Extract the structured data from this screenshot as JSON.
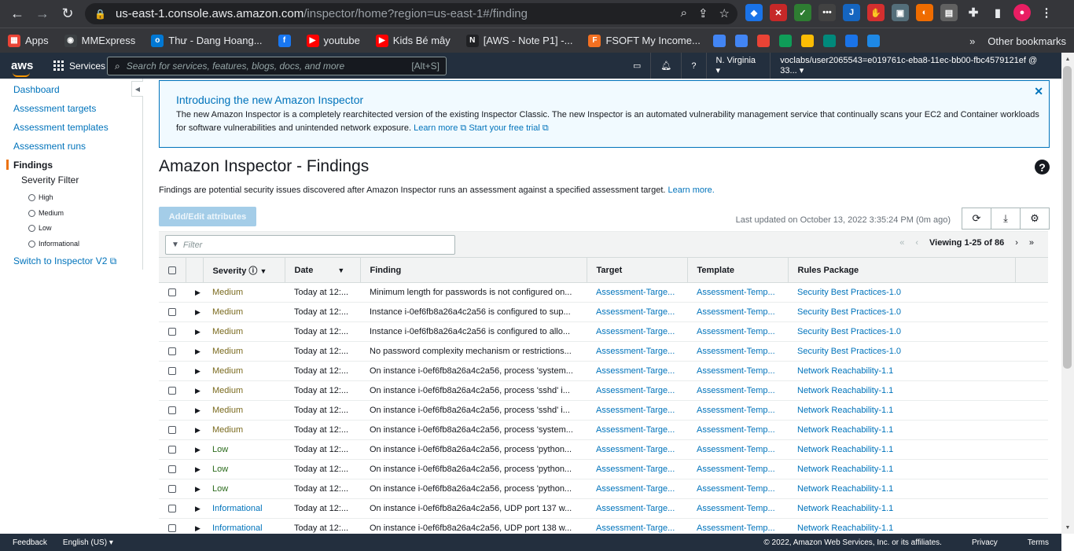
{
  "browser": {
    "url_host": "us-east-1.console.aws.amazon.com",
    "url_path": "/inspector/home?region=us-east-1#/finding",
    "bookmarks": [
      {
        "label": "Apps",
        "color": "#ea4335",
        "glyph": "▦"
      },
      {
        "label": "MMExpress",
        "color": "#3c4043",
        "glyph": "◉"
      },
      {
        "label": "Thư - Dang Hoang...",
        "color": "#0078d4",
        "glyph": "o"
      },
      {
        "label": "",
        "color": "#1877f2",
        "glyph": "f"
      },
      {
        "label": "youtube",
        "color": "#ff0000",
        "glyph": "▶"
      },
      {
        "label": "Kids Bé mây",
        "color": "#ff0000",
        "glyph": "▶"
      },
      {
        "label": "[AWS - Note P1] -...",
        "color": "#202124",
        "glyph": "N"
      },
      {
        "label": "FSOFT My Income...",
        "color": "#f37021",
        "glyph": "F"
      }
    ],
    "other_bookmarks": "Other bookmarks"
  },
  "aws_nav": {
    "logo": "aws",
    "services": "Services",
    "search_placeholder": "Search for services, features, blogs, docs, and more",
    "search_hint": "[Alt+S]",
    "region": "N. Virginia ▾",
    "account": "voclabs/user2065543=e019761c-eba8-11ec-bb00-fbc4579121ef @ 33... ▾"
  },
  "sidebar": {
    "items": [
      "Dashboard",
      "Assessment targets",
      "Assessment templates",
      "Assessment runs",
      "Findings"
    ],
    "severity_filter": "Severity Filter",
    "severities": [
      "High",
      "Medium",
      "Low",
      "Informational"
    ],
    "switch_v2": "Switch to Inspector V2 ⧉"
  },
  "banner": {
    "title": "Introducing the new Amazon Inspector",
    "text": "The new Amazon Inspector is a completely rearchitected version of the existing Inspector Classic. The new Inspector is an automated vulnerability management service that continually scans your EC2 and Container workloads for software vulnerabilities and unintended network exposure.",
    "learn_more": "Learn more ⧉",
    "free_trial": "Start your free trial ⧉"
  },
  "page": {
    "title": "Amazon Inspector - Findings",
    "description": "Findings are potential security issues discovered after Amazon Inspector runs an assessment against a specified assessment target.",
    "description_link": "Learn more.",
    "add_edit_button": "Add/Edit attributes",
    "last_updated": "Last updated on October 13, 2022 3:35:24 PM (0m ago)",
    "filter_placeholder": "Filter",
    "viewing": "Viewing 1-25 of 86"
  },
  "table": {
    "columns": [
      "Severity ⓘ",
      "Date",
      "Finding",
      "Target",
      "Template",
      "Rules Package"
    ],
    "rows": [
      {
        "severity": "Medium",
        "date": "Today at 12:...",
        "finding": "Minimum length for passwords is not configured on...",
        "target": "Assessment-Targe...",
        "template": "Assessment-Temp...",
        "rules": "Security Best Practices-1.0"
      },
      {
        "severity": "Medium",
        "date": "Today at 12:...",
        "finding": "Instance i-0ef6fb8a26a4c2a56 is configured to sup...",
        "target": "Assessment-Targe...",
        "template": "Assessment-Temp...",
        "rules": "Security Best Practices-1.0"
      },
      {
        "severity": "Medium",
        "date": "Today at 12:...",
        "finding": "Instance i-0ef6fb8a26a4c2a56 is configured to allo...",
        "target": "Assessment-Targe...",
        "template": "Assessment-Temp...",
        "rules": "Security Best Practices-1.0"
      },
      {
        "severity": "Medium",
        "date": "Today at 12:...",
        "finding": "No password complexity mechanism or restrictions...",
        "target": "Assessment-Targe...",
        "template": "Assessment-Temp...",
        "rules": "Security Best Practices-1.0"
      },
      {
        "severity": "Medium",
        "date": "Today at 12:...",
        "finding": "On instance i-0ef6fb8a26a4c2a56, process 'system...",
        "target": "Assessment-Targe...",
        "template": "Assessment-Temp...",
        "rules": "Network Reachability-1.1"
      },
      {
        "severity": "Medium",
        "date": "Today at 12:...",
        "finding": "On instance i-0ef6fb8a26a4c2a56, process 'sshd' i...",
        "target": "Assessment-Targe...",
        "template": "Assessment-Temp...",
        "rules": "Network Reachability-1.1"
      },
      {
        "severity": "Medium",
        "date": "Today at 12:...",
        "finding": "On instance i-0ef6fb8a26a4c2a56, process 'sshd' i...",
        "target": "Assessment-Targe...",
        "template": "Assessment-Temp...",
        "rules": "Network Reachability-1.1"
      },
      {
        "severity": "Medium",
        "date": "Today at 12:...",
        "finding": "On instance i-0ef6fb8a26a4c2a56, process 'system...",
        "target": "Assessment-Targe...",
        "template": "Assessment-Temp...",
        "rules": "Network Reachability-1.1"
      },
      {
        "severity": "Low",
        "date": "Today at 12:...",
        "finding": "On instance i-0ef6fb8a26a4c2a56, process 'python...",
        "target": "Assessment-Targe...",
        "template": "Assessment-Temp...",
        "rules": "Network Reachability-1.1"
      },
      {
        "severity": "Low",
        "date": "Today at 12:...",
        "finding": "On instance i-0ef6fb8a26a4c2a56, process 'python...",
        "target": "Assessment-Targe...",
        "template": "Assessment-Temp...",
        "rules": "Network Reachability-1.1"
      },
      {
        "severity": "Low",
        "date": "Today at 12:...",
        "finding": "On instance i-0ef6fb8a26a4c2a56, process 'python...",
        "target": "Assessment-Targe...",
        "template": "Assessment-Temp...",
        "rules": "Network Reachability-1.1"
      },
      {
        "severity": "Informational",
        "date": "Today at 12:...",
        "finding": "On instance i-0ef6fb8a26a4c2a56, UDP port 137 w...",
        "target": "Assessment-Targe...",
        "template": "Assessment-Temp...",
        "rules": "Network Reachability-1.1"
      },
      {
        "severity": "Informational",
        "date": "Today at 12:...",
        "finding": "On instance i-0ef6fb8a26a4c2a56, UDP port 138 w...",
        "target": "Assessment-Targe...",
        "template": "Assessment-Temp...",
        "rules": "Network Reachability-1.1"
      }
    ]
  },
  "footer": {
    "feedback": "Feedback",
    "language": "English (US) ▾",
    "copyright": "© 2022, Amazon Web Services, Inc. or its affiliates.",
    "privacy": "Privacy",
    "terms": "Terms"
  }
}
